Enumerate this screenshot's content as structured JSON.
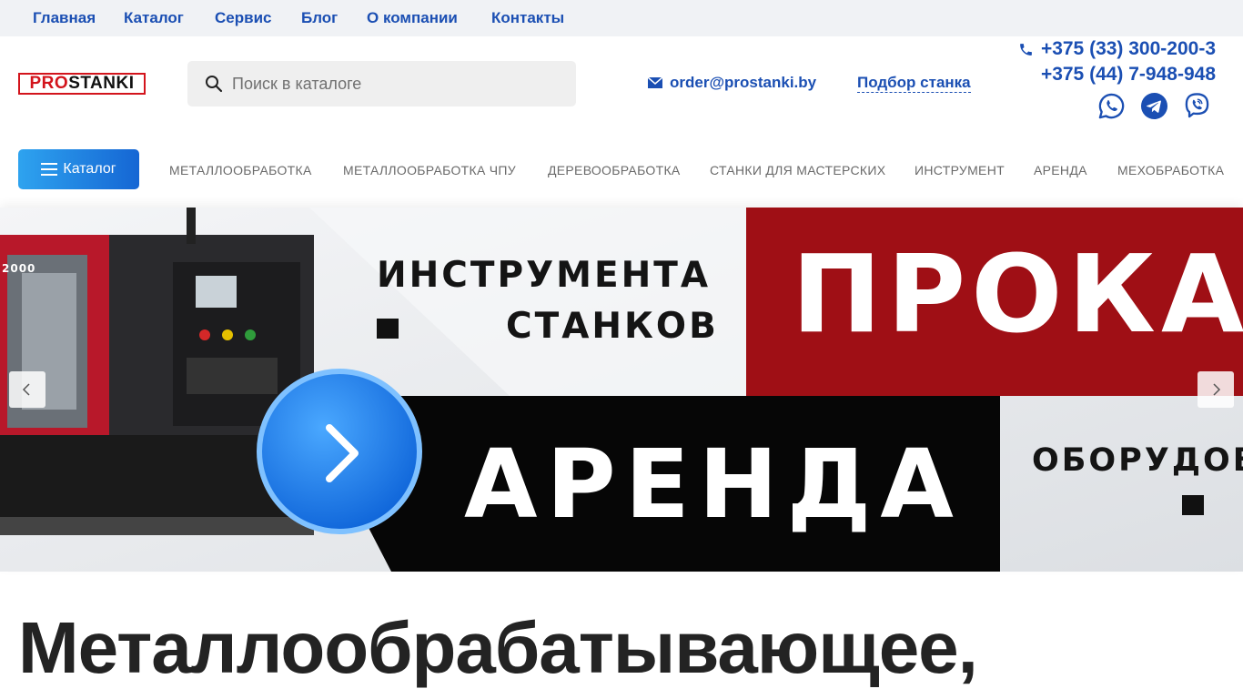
{
  "top_nav": [
    "Главная",
    "Каталог",
    "Сервис",
    "Блог",
    "О компании",
    "Контакты"
  ],
  "logo": {
    "pro": "PRO",
    "stanki": "STANKI"
  },
  "search": {
    "placeholder": "Поиск в каталоге"
  },
  "contacts": {
    "email": "order@prostanki.by",
    "pick_machine": "Подбор станка",
    "phone1": "+375 (33) 300-200-3",
    "phone2": "+375 (44) 7-948-948"
  },
  "socials": [
    "whatsapp-icon",
    "telegram-icon",
    "viber-icon"
  ],
  "catalog_button": "Каталог",
  "menu": [
    "МЕТАЛЛООБРАБОТКА",
    "МЕТАЛЛООБРАБОТКА ЧПУ",
    "ДЕРЕВООБРАБОТКА",
    "СТАНКИ ДЛЯ МАСТЕРСКИХ",
    "ИНСТРУМЕНТ",
    "АРЕНДА",
    "МЕХОБРАБОТКА"
  ],
  "banner": {
    "line1": "ИНСТРУМЕНТА",
    "line2": "СТАНКОВ",
    "big_red": "ПРОКА",
    "big_black": "АРЕНДА",
    "right_small": "ОБОРУДОВ",
    "machine_label": "2000"
  },
  "headline": "Металлообрабатывающее,",
  "colors": {
    "link": "#1b4fb3",
    "brand_red": "#d3141c",
    "banner_red": "#9f0f15",
    "banner_black": "#060606"
  }
}
